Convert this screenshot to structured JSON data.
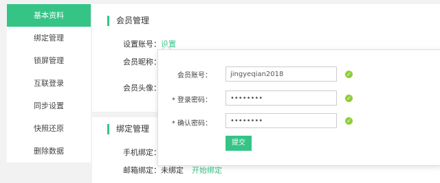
{
  "sidebar": {
    "items": [
      {
        "label": "基本资料",
        "active": true
      },
      {
        "label": "绑定管理"
      },
      {
        "label": "锁屏管理"
      },
      {
        "label": "互联登录"
      },
      {
        "label": "同步设置"
      },
      {
        "label": "快照还原"
      },
      {
        "label": "删除数据"
      }
    ]
  },
  "member": {
    "title": "会员管理",
    "account_label": "设置账号：",
    "account_link": "设置",
    "nickname_label": "会员昵称：",
    "avatar_label": "会员头像："
  },
  "binding": {
    "title": "绑定管理",
    "phone_label": "手机绑定：",
    "email_label": "邮箱绑定：",
    "email_status": "未绑定",
    "email_link": "开始绑定"
  },
  "popup": {
    "account_label": "会员账号：",
    "account_value": "jingyeqian2018",
    "password_label": "* 登录密码：",
    "password_value": "••••••••",
    "confirm_label": "* 确认密码：",
    "confirm_value": "••••••••",
    "submit_label": "提交",
    "check_icon": "check-circle-icon"
  },
  "colors": {
    "accent": "#35c486",
    "check": "#8fcf3c"
  }
}
